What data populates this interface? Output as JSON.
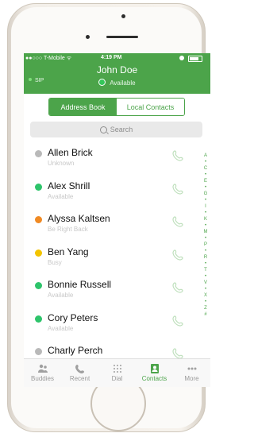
{
  "status_bar": {
    "carrier": "●●○○○ T-Mobile ᯤ",
    "time": "4:19 PM"
  },
  "header": {
    "title": "John Doe",
    "presence": "Available",
    "sip": "SIP"
  },
  "tabs": [
    {
      "label": "Address Book"
    },
    {
      "label": "Local Contacts"
    }
  ],
  "search": {
    "label": "Search"
  },
  "contacts": [
    {
      "name": "Allen Brick",
      "status": "Unknown",
      "color": "#b9b9b9"
    },
    {
      "name": "Alex Shrill",
      "status": "Available",
      "color": "#2ec46b"
    },
    {
      "name": "Alyssa Kaltsen",
      "status": "Be Right Back",
      "color": "#f08a24"
    },
    {
      "name": "Ben Yang",
      "status": "Busy",
      "color": "#f3c400"
    },
    {
      "name": "Bonnie Russell",
      "status": "Available",
      "color": "#2ec46b"
    },
    {
      "name": "Cory Peters",
      "status": "Available",
      "color": "#2ec46b"
    },
    {
      "name": "Charly Perch",
      "status": "",
      "color": "#b9b9b9"
    }
  ],
  "index": [
    "A",
    "•",
    "C",
    "•",
    "E",
    "•",
    "G",
    "•",
    "I",
    "•",
    "K",
    "•",
    "M",
    "•",
    "P",
    "•",
    "R",
    "•",
    "T",
    "•",
    "V",
    "•",
    "X",
    "•",
    "Z",
    "#"
  ],
  "tabbar": [
    {
      "label": "Buddies"
    },
    {
      "label": "Recent"
    },
    {
      "label": "Dial"
    },
    {
      "label": "Contacts"
    },
    {
      "label": "More"
    }
  ]
}
